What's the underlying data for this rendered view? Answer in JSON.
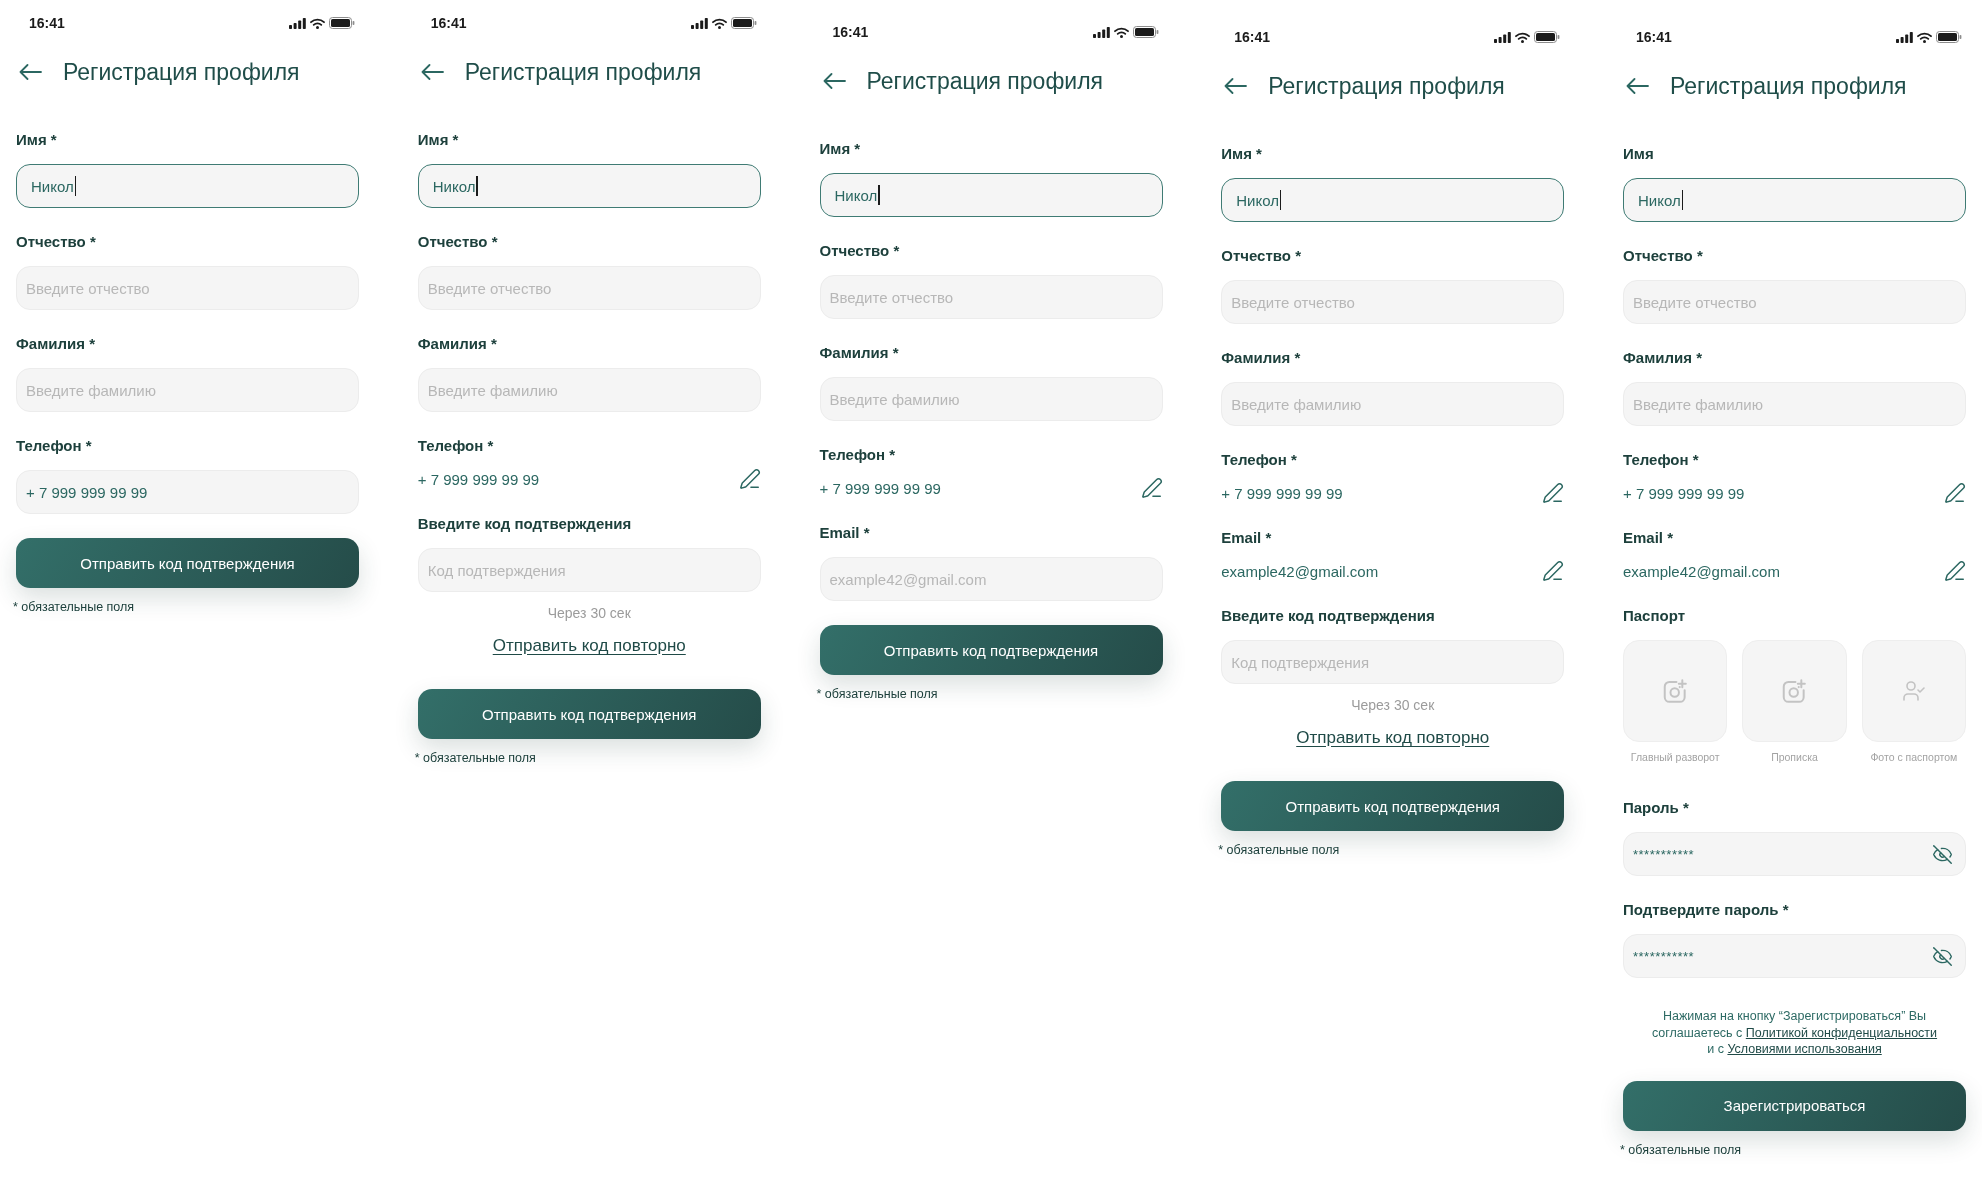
{
  "screens": [
    {
      "status_bar": {
        "time": "16:41"
      },
      "title": "Регистрация профиля",
      "fields": [
        {
          "kind": "input",
          "label": "Имя *",
          "value": "Никол",
          "focused": true
        },
        {
          "kind": "input",
          "label": "Отчество *",
          "placeholder": "Введите отчество",
          "focused": false
        },
        {
          "kind": "input",
          "label": "Фамилия *",
          "placeholder": "Введите фамилию",
          "focused": false
        },
        {
          "kind": "input",
          "label": "Телефон *",
          "value": "+ 7 999 999 99 99",
          "focused": false
        }
      ],
      "submit_button": "Отправить код подтверждения",
      "required_note": "* обязательные поля"
    },
    {
      "status_bar": {
        "time": "16:41"
      },
      "title": "Регистрация профиля",
      "fields": [
        {
          "kind": "input",
          "label": "Имя *",
          "value": "Никол",
          "focused": true
        },
        {
          "kind": "input",
          "label": "Отчество *",
          "placeholder": "Введите отчество",
          "focused": false
        },
        {
          "kind": "input",
          "label": "Фамилия *",
          "placeholder": "Введите фамилию",
          "focused": false
        },
        {
          "kind": "confirmed",
          "label": "Телефон *",
          "value": "+ 7 999 999 99 99"
        },
        {
          "kind": "code",
          "label": "Введите код подтверждения",
          "placeholder": "Код подтверждения",
          "focused": false,
          "timer": "Через 30 сек",
          "resend_link": "Отправить код повторно"
        }
      ],
      "submit_button": "Отправить код подтверждения",
      "required_note": "* обязательные поля"
    },
    {
      "status_bar": {
        "time": "16:41"
      },
      "title": "Регистрация профиля",
      "fields": [
        {
          "kind": "input",
          "label": "Имя *",
          "value": "Никол",
          "focused": true
        },
        {
          "kind": "input",
          "label": "Отчество *",
          "placeholder": "Введите отчество",
          "focused": false
        },
        {
          "kind": "input",
          "label": "Фамилия *",
          "placeholder": "Введите фамилию",
          "focused": false
        },
        {
          "kind": "confirmed",
          "label": "Телефон *",
          "value": "+ 7 999 999 99 99"
        },
        {
          "kind": "input",
          "label": "Email *",
          "placeholder": "example42@gmail.com",
          "focused": false
        }
      ],
      "submit_button": "Отправить код подтверждения",
      "required_note": "* обязательные поля"
    },
    {
      "status_bar": {
        "time": "16:41"
      },
      "title": "Регистрация профиля",
      "fields": [
        {
          "kind": "input",
          "label": "Имя *",
          "value": "Никол",
          "focused": true
        },
        {
          "kind": "input",
          "label": "Отчество *",
          "placeholder": "Введите отчество",
          "focused": false
        },
        {
          "kind": "input",
          "label": "Фамилия *",
          "placeholder": "Введите фамилию",
          "focused": false
        },
        {
          "kind": "confirmed",
          "label": "Телефон *",
          "value": "+ 7 999 999 99 99"
        },
        {
          "kind": "confirmed",
          "label": "Email *",
          "value": "example42@gmail.com"
        },
        {
          "kind": "code",
          "label": "Введите код подтверждения",
          "placeholder": "Код подтверждения",
          "focused": false,
          "timer": "Через 30 сек",
          "resend_link": "Отправить код повторно"
        }
      ],
      "submit_button": "Отправить код подтверждения",
      "required_note": "* обязательные поля"
    },
    {
      "status_bar": {
        "time": "16:41"
      },
      "title": "Регистрация профиля",
      "fields": [
        {
          "kind": "input",
          "label": "Имя",
          "value": "Никол",
          "focused": true
        },
        {
          "kind": "input",
          "label": "Отчество *",
          "placeholder": "Введите отчество",
          "focused": false
        },
        {
          "kind": "input",
          "label": "Фамилия *",
          "placeholder": "Введите фамилию",
          "focused": false
        },
        {
          "kind": "confirmed",
          "label": "Телефон *",
          "value": "+ 7 999 999 99 99"
        },
        {
          "kind": "confirmed",
          "label": "Email *",
          "value": "example42@gmail.com"
        },
        {
          "kind": "passport",
          "label": "Паспорт",
          "slots": [
            {
              "kind": "document",
              "caption": "Главный разворот"
            },
            {
              "kind": "document",
              "caption": "Прописка"
            },
            {
              "kind": "selfie",
              "caption": "Фото с паспортом"
            }
          ]
        },
        {
          "kind": "password",
          "label": "Пароль *",
          "value": "***********",
          "focused": false
        },
        {
          "kind": "password",
          "label": "Подтвердите пароль *",
          "value": "***********",
          "focused": false
        }
      ],
      "consent": {
        "text": "Нажимая на кнопку “Зарегистрироваться” Вы соглашаетесь с ",
        "privacy_link": "Политикой конфиденциальности",
        "middle": " и с ",
        "terms_link": "Условиями использования"
      },
      "submit_button": "Зарегистрироваться",
      "required_note": "* обязательные поля"
    }
  ]
}
